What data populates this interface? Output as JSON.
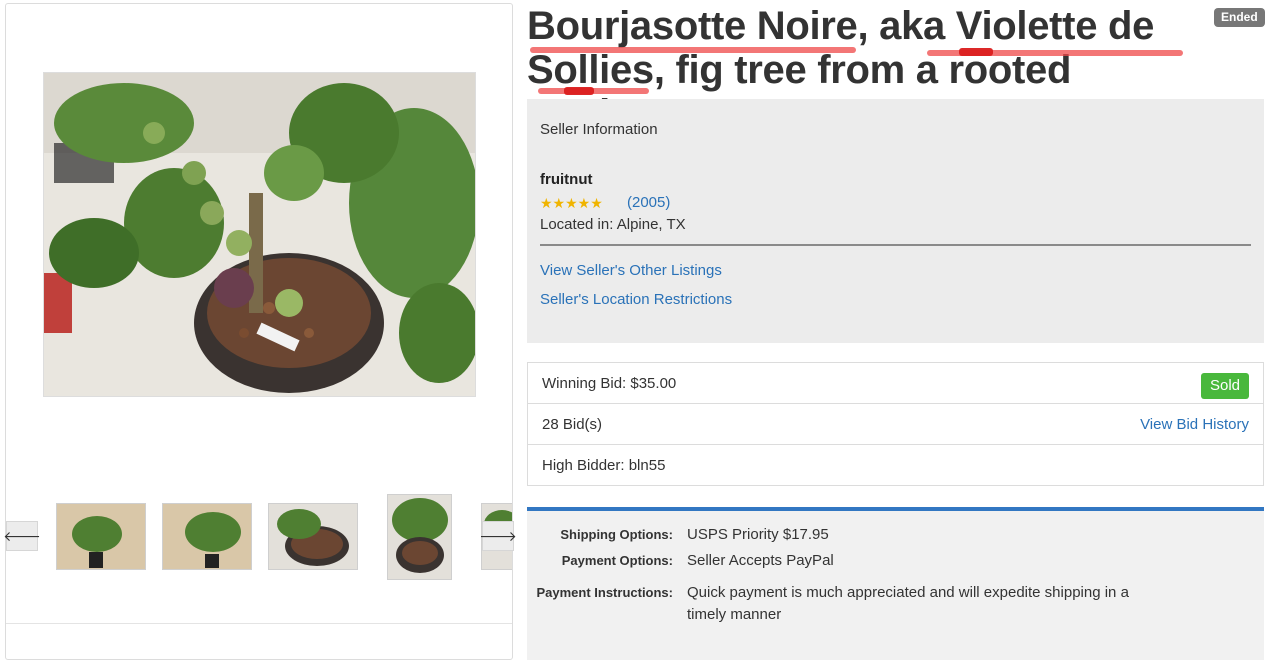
{
  "listing": {
    "title": "Bourjasotte Noire, aka Violette de Sollies, fig tree from a rooted cutting",
    "status": "Ended"
  },
  "gallery": {
    "prev_icon": "arrow-left-icon",
    "next_icon": "arrow-right-icon",
    "thumbnail_count_visible": 5
  },
  "seller": {
    "heading": "Seller Information",
    "name": "fruitnut",
    "rating_stars": "★★★★★",
    "feedback_count": "(2005)",
    "location": "Located in: Alpine, TX",
    "links": [
      "View Seller's Other Listings",
      "Seller's Location Restrictions"
    ]
  },
  "bidding": {
    "winning_bid": "Winning Bid: $35.00",
    "sold_badge": "Sold",
    "bid_count": "28 Bid(s)",
    "bid_history_link": "View Bid History",
    "high_bidder": "High Bidder: bln55"
  },
  "shipping": {
    "shipping_label": "Shipping Options:",
    "shipping_value": "USPS Priority $17.95",
    "payment_label": "Payment Options:",
    "payment_value": "Seller Accepts PayPal",
    "instructions_label": "Payment Instructions:",
    "instructions_value": "Quick payment is much appreciated and will expedite shipping in a timely manner"
  },
  "colors": {
    "link": "#2a72b8",
    "sold": "#49b83c",
    "ended": "#777777",
    "accent_bar": "#3277c2",
    "spellcheck": "#ef4848"
  }
}
